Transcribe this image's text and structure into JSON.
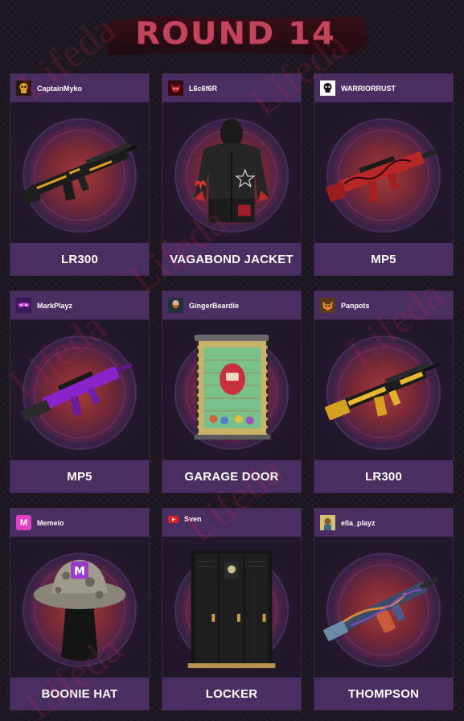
{
  "header": {
    "title": "ROUND 14"
  },
  "watermark": "Lifeda",
  "cards": [
    {
      "username": "CaptainMyko",
      "item": "LR300",
      "avatar_icon": "skull-avatar-icon",
      "avatar_color": "#3a2a10",
      "item_icon": "lr300-rifle-icon"
    },
    {
      "username": "L6c6f6R",
      "item": "VAGABOND JACKET",
      "avatar_icon": "demon-avatar-icon",
      "avatar_color": "#6a1018",
      "item_icon": "vagabond-jacket-icon"
    },
    {
      "username": "WARRIORRUST",
      "item": "MP5",
      "avatar_icon": "skull-logo-avatar-icon",
      "avatar_color": "#ffffff",
      "item_icon": "mp5-red-icon"
    },
    {
      "username": "MarkPlayz",
      "item": "MP5",
      "avatar_icon": "mask-avatar-icon",
      "avatar_color": "#5a2a80",
      "item_icon": "mp5-purple-icon"
    },
    {
      "username": "GingerBeardie",
      "item": "GARAGE DOOR",
      "avatar_icon": "bearded-avatar-icon",
      "avatar_color": "#2a3a4a",
      "item_icon": "garage-door-icon"
    },
    {
      "username": "Panpots",
      "item": "LR300",
      "avatar_icon": "fox-avatar-icon",
      "avatar_color": "#8a5a20",
      "item_icon": "lr300-yellow-icon"
    },
    {
      "username": "Memeio",
      "item": "BOONIE HAT",
      "avatar_icon": "m-logo-avatar-icon",
      "avatar_color": "#e040c8",
      "avatar_letter": "M",
      "item_icon": "boonie-hat-icon"
    },
    {
      "username": "Sven",
      "item": "LOCKER",
      "avatar_icon": "youtube-icon",
      "avatar_color": "#e02020",
      "item_icon": "locker-icon"
    },
    {
      "username": "ella_playz",
      "item": "THOMPSON",
      "avatar_icon": "character-avatar-icon",
      "avatar_color": "#c8b060",
      "item_icon": "thompson-icon"
    }
  ]
}
